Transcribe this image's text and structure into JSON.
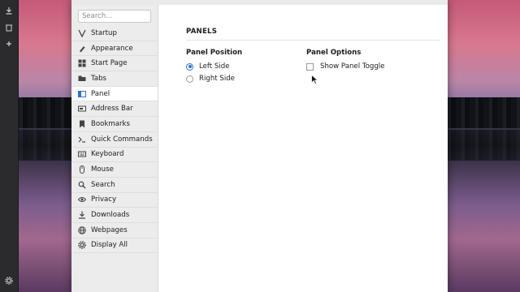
{
  "left_strip": {
    "icons": [
      "download-icon",
      "trash-icon",
      "plus-icon",
      "gear-icon"
    ]
  },
  "sidebar": {
    "search_placeholder": "Search...",
    "items": [
      {
        "label": "Startup",
        "icon": "startup-icon"
      },
      {
        "label": "Appearance",
        "icon": "appearance-icon"
      },
      {
        "label": "Start Page",
        "icon": "start-page-icon"
      },
      {
        "label": "Tabs",
        "icon": "tabs-icon"
      },
      {
        "label": "Panel",
        "icon": "panel-icon",
        "active": true
      },
      {
        "label": "Address Bar",
        "icon": "address-bar-icon"
      },
      {
        "label": "Bookmarks",
        "icon": "bookmark-icon"
      },
      {
        "label": "Quick Commands",
        "icon": "quick-commands-icon"
      },
      {
        "label": "Keyboard",
        "icon": "keyboard-icon"
      },
      {
        "label": "Mouse",
        "icon": "mouse-icon"
      },
      {
        "label": "Search",
        "icon": "search-icon"
      },
      {
        "label": "Privacy",
        "icon": "eye-icon"
      },
      {
        "label": "Downloads",
        "icon": "download-icon"
      },
      {
        "label": "Webpages",
        "icon": "globe-icon"
      },
      {
        "label": "Display All",
        "icon": "gear-icon"
      }
    ]
  },
  "content": {
    "section_title": "PANELS",
    "panel_position": {
      "title": "Panel Position",
      "options": [
        {
          "label": "Left Side",
          "checked": true
        },
        {
          "label": "Right Side",
          "checked": false
        }
      ]
    },
    "panel_options": {
      "title": "Panel Options",
      "options": [
        {
          "label": "Show Panel Toggle",
          "checked": false
        }
      ]
    }
  },
  "colors": {
    "accent": "#2f6fd6",
    "sidebar_bg": "#ececec",
    "active_item_bg": "#ffffff"
  }
}
